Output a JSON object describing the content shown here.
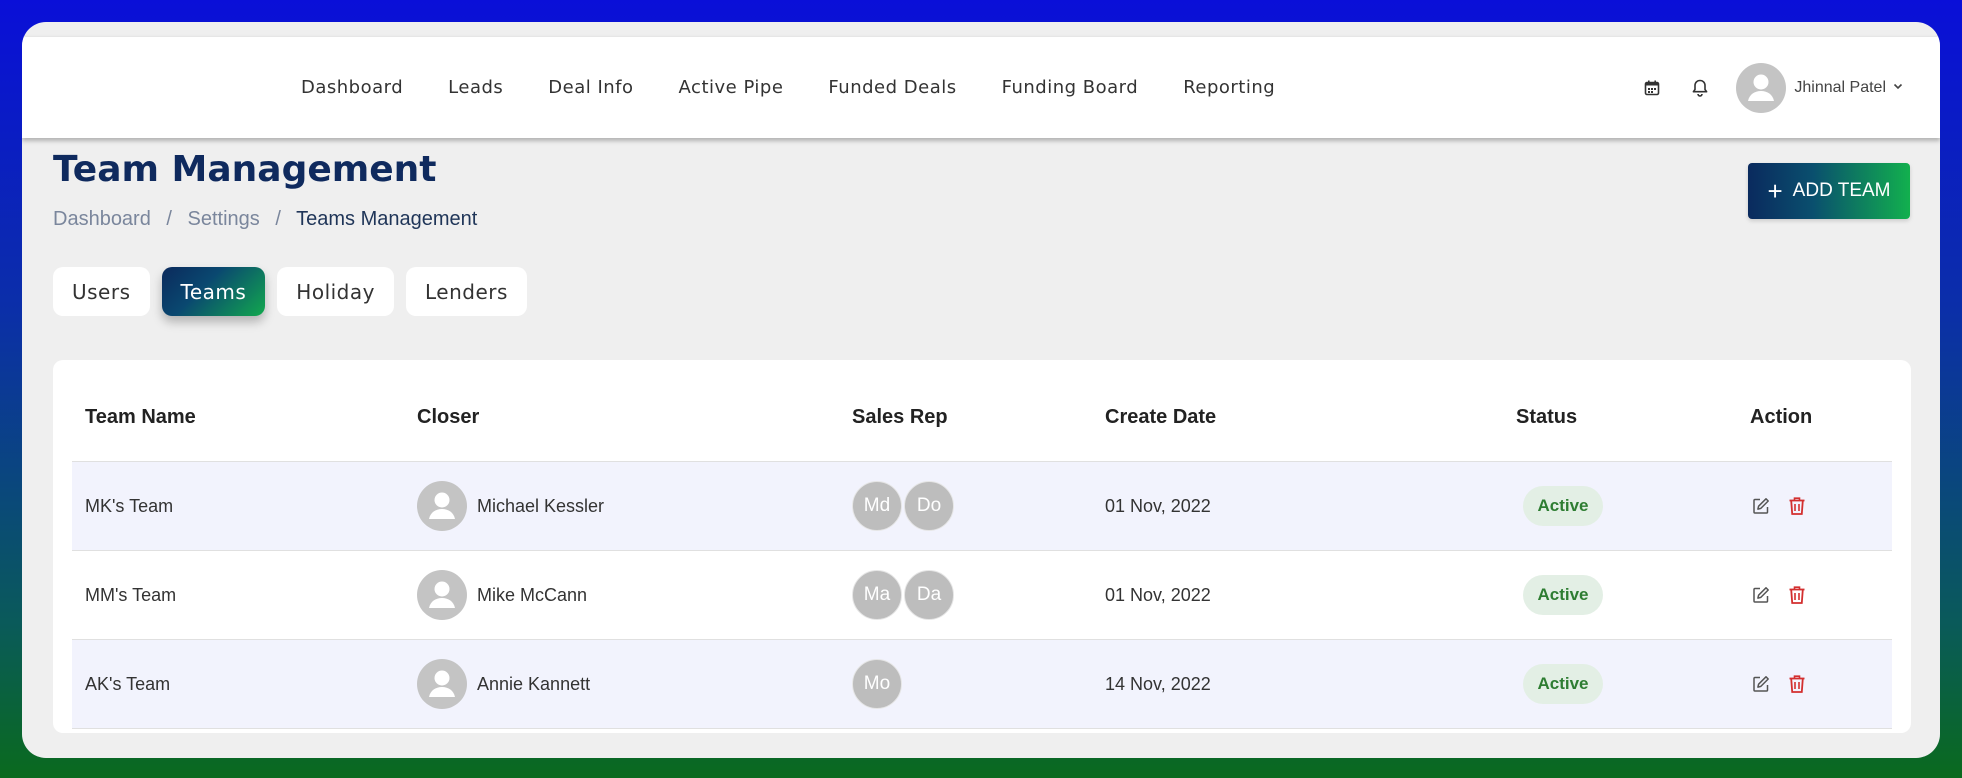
{
  "nav": {
    "items": [
      "Dashboard",
      "Leads",
      "Deal Info",
      "Active Pipe",
      "Funded Deals",
      "Funding Board",
      "Reporting"
    ]
  },
  "user": {
    "name": "Jhinnal Patel"
  },
  "icons": {
    "calendar": "calendar-icon",
    "bell": "bell-icon",
    "avatar": "user-avatar-icon",
    "chevron": "chevron-down-icon",
    "edit": "edit-icon",
    "delete": "trash-icon",
    "plus": "plus-icon"
  },
  "page": {
    "title": "Team Management",
    "breadcrumb": [
      "Dashboard",
      "Settings",
      "Teams Management"
    ],
    "add_button": "ADD TEAM"
  },
  "tabs": [
    {
      "label": "Users",
      "active": false
    },
    {
      "label": "Teams",
      "active": true
    },
    {
      "label": "Holiday",
      "active": false
    },
    {
      "label": "Lenders",
      "active": false
    }
  ],
  "table": {
    "headers": [
      "Team Name",
      "Closer",
      "Sales Rep",
      "Create Date",
      "Status",
      "Action"
    ],
    "rows": [
      {
        "team": "MK's Team",
        "closer": "Michael Kessler",
        "reps": [
          "Md",
          "Do"
        ],
        "date": "01 Nov, 2022",
        "status": "Active"
      },
      {
        "team": "MM's Team",
        "closer": "Mike McCann",
        "reps": [
          "Ma",
          "Da"
        ],
        "date": "01 Nov, 2022",
        "status": "Active"
      },
      {
        "team": "AK's Team",
        "closer": "Annie Kannett",
        "reps": [
          "Mo"
        ],
        "date": "14 Nov, 2022",
        "status": "Active"
      }
    ]
  },
  "colors": {
    "title": "#0f2a5e",
    "status_text": "#2e7d32",
    "status_bg": "#e3efe5",
    "delete_icon": "#d32f2f",
    "button_gradient_start": "#0a2a5e",
    "button_gradient_end": "#12b04e"
  }
}
